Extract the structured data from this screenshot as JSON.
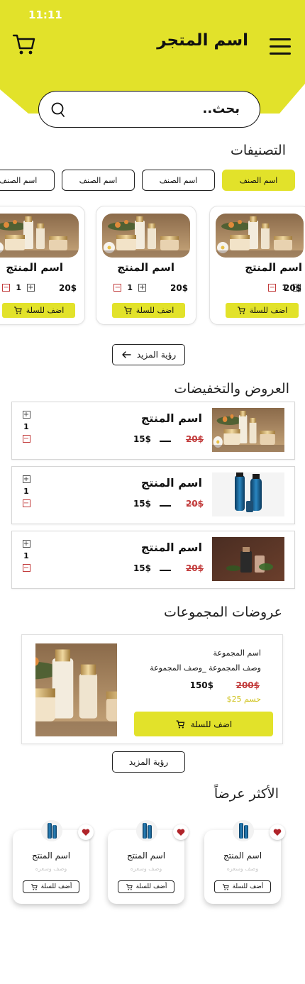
{
  "status": {
    "time": "11:11"
  },
  "header": {
    "store_name": "اسم المتجر",
    "accent": "#e2e22a"
  },
  "search": {
    "text": "بحث.."
  },
  "categories": {
    "title": "التصنيفات",
    "chips": [
      "اسم الصنف",
      "اسم الصنف",
      "اسم الصنف",
      "اسم الصنف"
    ]
  },
  "products": [
    {
      "name": "اسم المنتج",
      "price": "20$",
      "qty": "1",
      "add": "اضف للسلة"
    },
    {
      "name": "اسم المنتج",
      "price": "20$",
      "qty": "1",
      "add": "اضف للسلة"
    },
    {
      "name": "اسم المنتج",
      "price": "20$",
      "qty": "1",
      "add": "اضف للسلة"
    }
  ],
  "see_more": "رؤية المزيد",
  "offers": {
    "title": "العروض والتخفيضات",
    "items": [
      {
        "name": "اسم المنتج",
        "new_price": "15$",
        "old_price": "20$",
        "qty": "1"
      },
      {
        "name": "اسم المنتج",
        "new_price": "15$",
        "old_price": "20$",
        "qty": "1"
      },
      {
        "name": "اسم المنتج",
        "new_price": "15$",
        "old_price": "20$",
        "qty": "1"
      }
    ]
  },
  "bundles": {
    "title": "عروضات المجموعات",
    "name": "اسم المجموعة",
    "desc": "وصف المجموعة _وصف المجموعة",
    "new_price": "150$",
    "old_price": "200$",
    "discount": "حسم 25$",
    "add": "اضف للسلة",
    "see_more": "رؤية المزيد"
  },
  "bestsellers": {
    "title": "الأكثر عرضاً",
    "items": [
      {
        "name": "اسم المنتج",
        "desc": "وصف وسعره",
        "add": "أضف للسلة"
      },
      {
        "name": "اسم المنتج",
        "desc": "وصف وسعره",
        "add": "أضف للسلة"
      },
      {
        "name": "اسم المنتج",
        "desc": "وصف وسعره",
        "add": "أضف للسلة"
      }
    ]
  }
}
